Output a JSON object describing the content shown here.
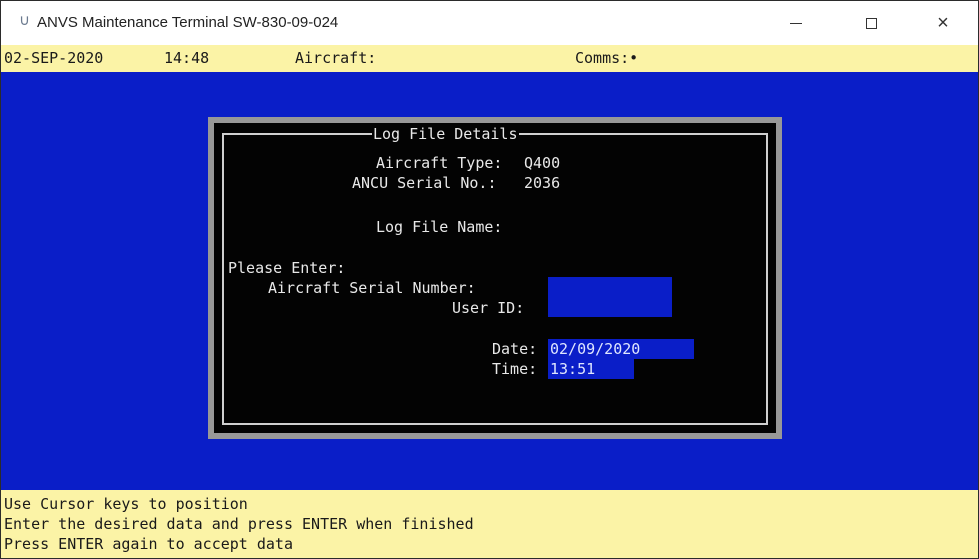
{
  "window": {
    "title": "ANVS Maintenance Terminal SW-830-09-024",
    "icon": "terminal-app-icon",
    "minimize_icon": "minimize-icon",
    "maximize_icon": "maximize-icon",
    "close_icon": "close-icon",
    "close_glyph": "×"
  },
  "status": {
    "date": "02-SEP-2020",
    "time": "14:48",
    "aircraft_label": "Aircraft:",
    "comms_label": "Comms:•"
  },
  "dialog": {
    "title": "Log File Details",
    "aircraft_type_label": "Aircraft Type:",
    "aircraft_type_value": "Q400",
    "ancu_serial_label": "ANCU Serial No.:",
    "ancu_serial_value": "2036",
    "log_file_name_label": "Log File Name:",
    "please_enter": "Please Enter:",
    "aircraft_serial_label": "Aircraft Serial Number:",
    "aircraft_serial_value": "",
    "user_id_label": "User ID:",
    "user_id_value": "",
    "date_label": "Date:",
    "date_value": "02/09/2020",
    "time_label": "Time:",
    "time_value": "13:51"
  },
  "help": {
    "line1": "Use Cursor keys to position",
    "line2": "Enter the desired data and press ENTER when finished",
    "line3": "Press ENTER again to accept data"
  },
  "colors": {
    "terminal_background": "#0a1ec8",
    "status_background": "#fbf3a6",
    "dialog_background": "#030303",
    "dialog_text": "#e8e8e8",
    "field_background": "#0a1ec8"
  }
}
